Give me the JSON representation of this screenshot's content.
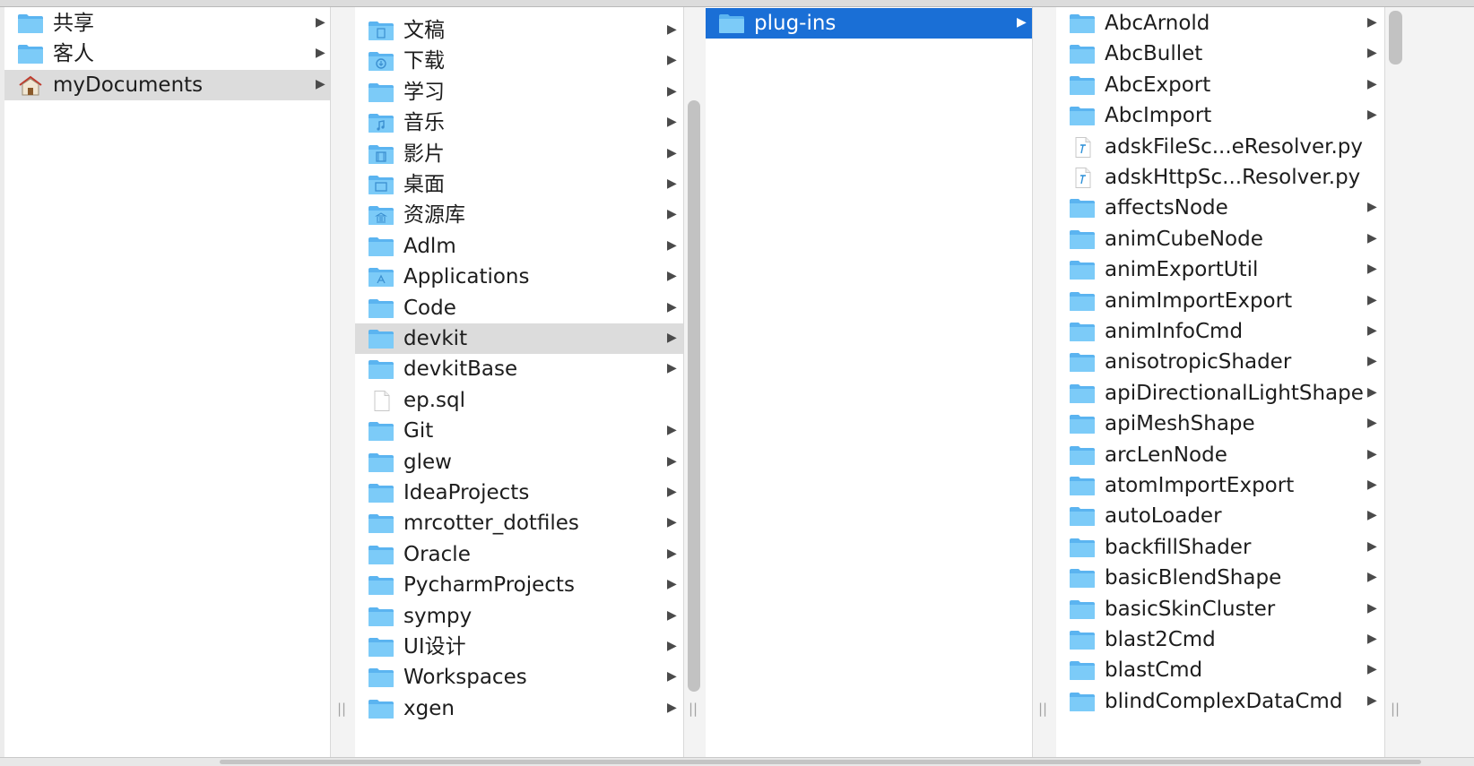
{
  "window": {
    "view": "Finder column view"
  },
  "colors": {
    "selection_blue": "#1a6fd6",
    "selection_gray": "#dcdcdc",
    "folder_blue": "#6ec0f5"
  },
  "columns": [
    {
      "name": "column-1",
      "items": [
        {
          "label": "共享",
          "icon": "folder-icon",
          "arrow": true
        },
        {
          "label": "客人",
          "icon": "folder-icon",
          "arrow": true
        },
        {
          "label": "myDocuments",
          "icon": "home-icon",
          "arrow": true,
          "selected": "gray"
        }
      ]
    },
    {
      "name": "column-2",
      "items": [
        {
          "label": "文稿",
          "icon": "documents-folder-icon",
          "arrow": true
        },
        {
          "label": "下载",
          "icon": "downloads-folder-icon",
          "arrow": true
        },
        {
          "label": "学习",
          "icon": "folder-icon",
          "arrow": true
        },
        {
          "label": "音乐",
          "icon": "music-folder-icon",
          "arrow": true
        },
        {
          "label": "影片",
          "icon": "movies-folder-icon",
          "arrow": true
        },
        {
          "label": "桌面",
          "icon": "desktop-folder-icon",
          "arrow": true
        },
        {
          "label": "资源库",
          "icon": "library-folder-icon",
          "arrow": true
        },
        {
          "label": "Adlm",
          "icon": "folder-icon",
          "arrow": true
        },
        {
          "label": "Applications",
          "icon": "applications-folder-icon",
          "arrow": true
        },
        {
          "label": "Code",
          "icon": "folder-icon",
          "arrow": true
        },
        {
          "label": "devkit",
          "icon": "folder-icon",
          "arrow": true,
          "selected": "gray"
        },
        {
          "label": "devkitBase",
          "icon": "folder-icon",
          "arrow": true
        },
        {
          "label": "ep.sql",
          "icon": "file-icon",
          "arrow": false
        },
        {
          "label": "Git",
          "icon": "folder-icon",
          "arrow": true
        },
        {
          "label": "glew",
          "icon": "folder-icon",
          "arrow": true
        },
        {
          "label": "IdeaProjects",
          "icon": "folder-icon",
          "arrow": true
        },
        {
          "label": "mrcotter_dotfiles",
          "icon": "folder-icon",
          "arrow": true
        },
        {
          "label": "Oracle",
          "icon": "folder-icon",
          "arrow": true
        },
        {
          "label": "PycharmProjects",
          "icon": "folder-icon",
          "arrow": true
        },
        {
          "label": "sympy",
          "icon": "folder-icon",
          "arrow": true
        },
        {
          "label": "UI设计",
          "icon": "folder-icon",
          "arrow": true
        },
        {
          "label": "Workspaces",
          "icon": "folder-icon",
          "arrow": true
        },
        {
          "label": "xgen",
          "icon": "folder-icon",
          "arrow": true
        }
      ]
    },
    {
      "name": "column-3",
      "items": [
        {
          "label": "plug-ins",
          "icon": "folder-icon",
          "arrow": true,
          "selected": "blue"
        }
      ]
    },
    {
      "name": "column-4",
      "items": [
        {
          "label": "AbcArnold",
          "icon": "folder-icon",
          "arrow": true
        },
        {
          "label": "AbcBullet",
          "icon": "folder-icon",
          "arrow": true
        },
        {
          "label": "AbcExport",
          "icon": "folder-icon",
          "arrow": true
        },
        {
          "label": "AbcImport",
          "icon": "folder-icon",
          "arrow": true
        },
        {
          "label": "adskFileSc...eResolver.py",
          "icon": "python-file-icon",
          "arrow": false
        },
        {
          "label": "adskHttpSc...Resolver.py",
          "icon": "python-file-icon",
          "arrow": false
        },
        {
          "label": "affectsNode",
          "icon": "folder-icon",
          "arrow": true
        },
        {
          "label": "animCubeNode",
          "icon": "folder-icon",
          "arrow": true
        },
        {
          "label": "animExportUtil",
          "icon": "folder-icon",
          "arrow": true
        },
        {
          "label": "animImportExport",
          "icon": "folder-icon",
          "arrow": true
        },
        {
          "label": "animInfoCmd",
          "icon": "folder-icon",
          "arrow": true
        },
        {
          "label": "anisotropicShader",
          "icon": "folder-icon",
          "arrow": true
        },
        {
          "label": "apiDirectionalLightShape",
          "icon": "folder-icon",
          "arrow": true
        },
        {
          "label": "apiMeshShape",
          "icon": "folder-icon",
          "arrow": true
        },
        {
          "label": "arcLenNode",
          "icon": "folder-icon",
          "arrow": true
        },
        {
          "label": "atomImportExport",
          "icon": "folder-icon",
          "arrow": true
        },
        {
          "label": "autoLoader",
          "icon": "folder-icon",
          "arrow": true
        },
        {
          "label": "backfillShader",
          "icon": "folder-icon",
          "arrow": true
        },
        {
          "label": "basicBlendShape",
          "icon": "folder-icon",
          "arrow": true
        },
        {
          "label": "basicSkinCluster",
          "icon": "folder-icon",
          "arrow": true
        },
        {
          "label": "blast2Cmd",
          "icon": "folder-icon",
          "arrow": true
        },
        {
          "label": "blastCmd",
          "icon": "folder-icon",
          "arrow": true
        },
        {
          "label": "blindComplexDataCmd",
          "icon": "folder-icon",
          "arrow": true
        }
      ]
    }
  ]
}
